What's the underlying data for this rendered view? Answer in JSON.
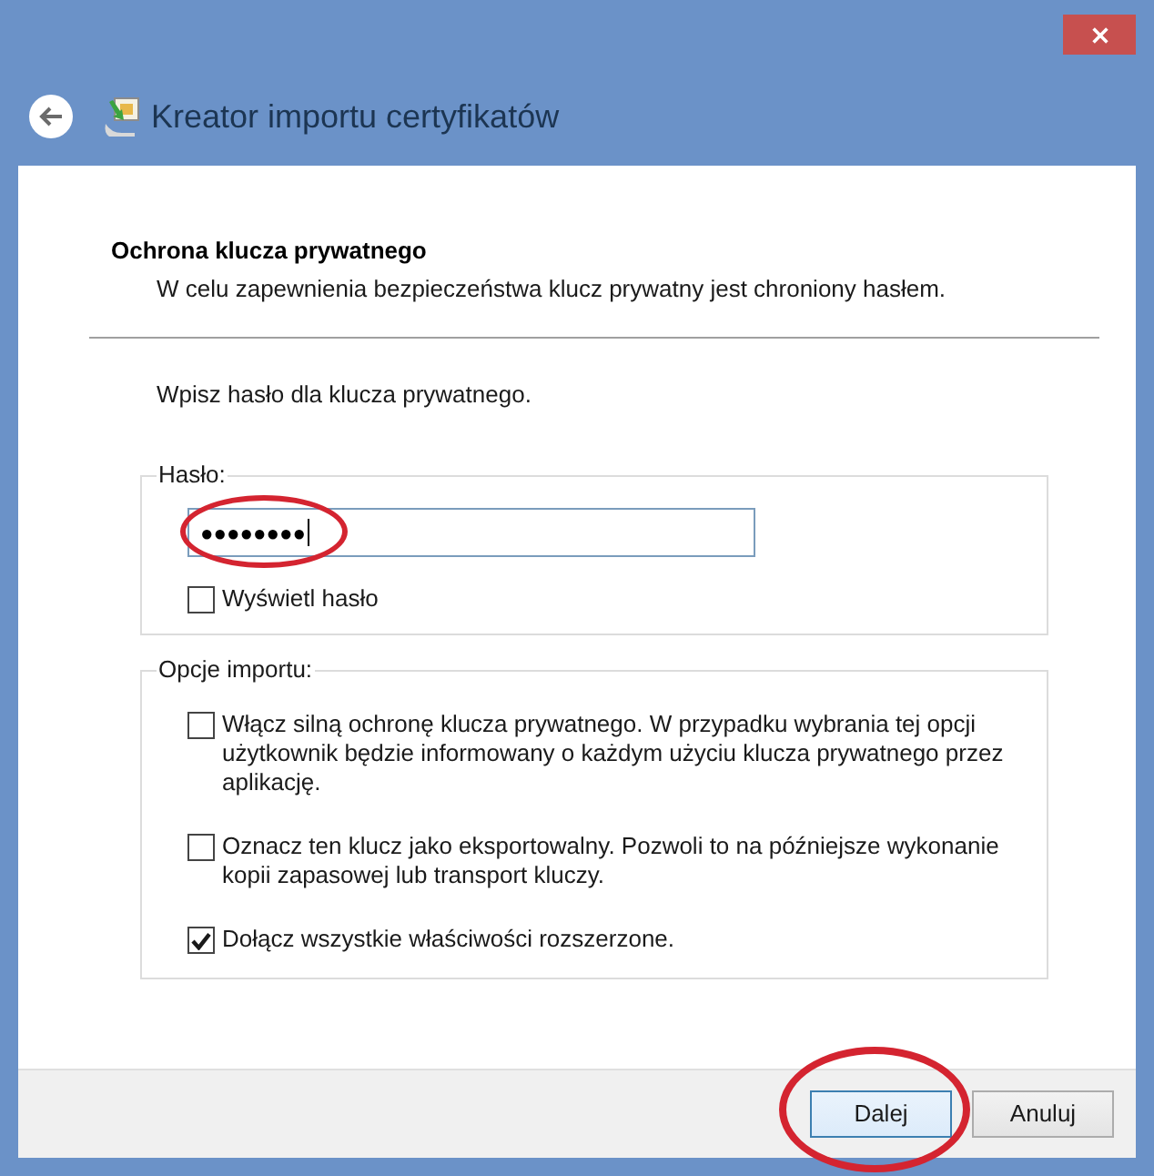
{
  "window": {
    "title": "Kreator importu certyfikatów"
  },
  "page": {
    "heading": "Ochrona klucza prywatnego",
    "description": "W celu zapewnienia bezpieczeństwa klucz prywatny jest chroniony hasłem."
  },
  "instruction": "Wpisz hasło dla klucza prywatnego.",
  "password_group": {
    "legend": "Hasło:",
    "password": {
      "value": "●●●●●●●●",
      "focused": true,
      "highlighted": true
    },
    "show_password": {
      "label": "Wyświetl hasło",
      "checked": false
    }
  },
  "import_options": {
    "legend": "Opcje importu:",
    "options": [
      {
        "label": "Włącz silną ochronę klucza prywatnego. W przypadku wybrania tej opcji użytkownik będzie informowany o każdym użyciu klucza prywatnego przez aplikację.",
        "checked": false
      },
      {
        "label": "Oznacz ten klucz jako eksportowalny. Pozwoli to na późniejsze wykonanie kopii zapasowej lub transport kluczy.",
        "checked": false
      },
      {
        "label": "Dołącz wszystkie właściwości rozszerzone.",
        "checked": true
      }
    ]
  },
  "buttons": [
    {
      "label": "Dalej",
      "default": true,
      "highlighted": true
    },
    {
      "label": "Anuluj",
      "default": false,
      "highlighted": false
    }
  ]
}
